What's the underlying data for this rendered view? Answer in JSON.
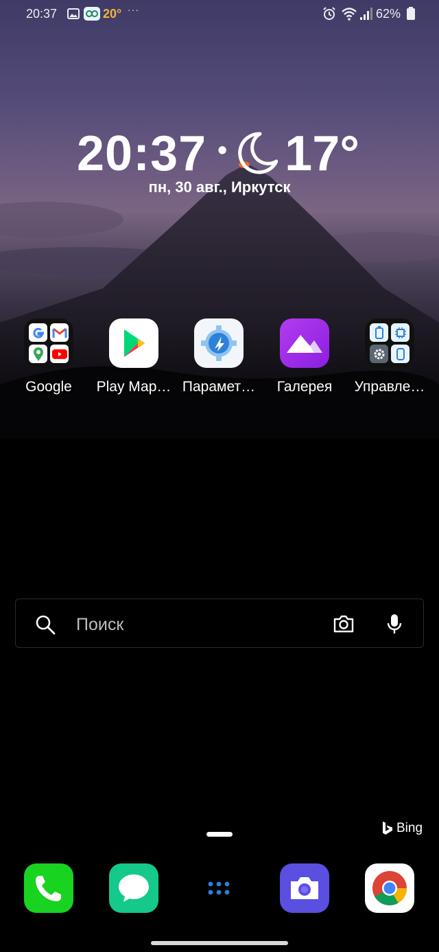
{
  "status_bar": {
    "time": "20:37",
    "temperature": "20°",
    "overflow": "···",
    "battery_percent": "62%",
    "accent_temp_color": "#f2b53a"
  },
  "clock_widget": {
    "time": "20:37",
    "separator": "•",
    "weather_icon": "moon-icon",
    "temperature": "17°",
    "date_location": "пн, 30 авг., Иркутск"
  },
  "apps": [
    {
      "label": "Google",
      "icon": "google-folder-icon"
    },
    {
      "label": "Play Мар…",
      "icon": "play-store-icon"
    },
    {
      "label": "Парамет…",
      "icon": "settings-app-icon"
    },
    {
      "label": "Галерея",
      "icon": "gallery-icon"
    },
    {
      "label": "Управле…",
      "icon": "device-care-folder-icon"
    }
  ],
  "search": {
    "placeholder": "Поиск"
  },
  "bing": {
    "label": "Bing"
  },
  "dock": [
    {
      "name": "phone",
      "icon": "phone-icon",
      "color": "#18d31f"
    },
    {
      "name": "messages",
      "icon": "messages-icon",
      "color": "#14c98a"
    },
    {
      "name": "app-drawer",
      "icon": "app-drawer-icon",
      "color": "#2a7fe0"
    },
    {
      "name": "camera",
      "icon": "camera-app-icon",
      "color": "#5a4fe0"
    },
    {
      "name": "chrome",
      "icon": "chrome-icon",
      "color": "#ffffff"
    }
  ]
}
